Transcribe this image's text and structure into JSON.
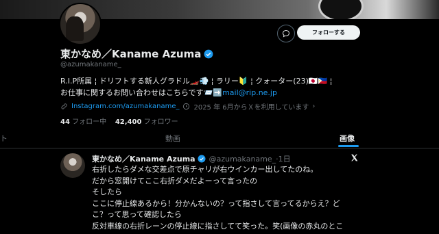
{
  "profile": {
    "name": "東かなめ／Kaname Azuma",
    "handle": "@azumakaname_",
    "bio_line1": "R.I.P所属 ¦ ドリフトする新人グラドル🏎️💨 ¦ ラリー🔰 ¦ クォーター(23)🇯🇵🇵🇭 ¦",
    "bio_line2_text": "お仕事に関するお問い合わせはこちらです📨➡️",
    "bio_line2_link": "mail@rip.ne.jp",
    "website": "Instagram.com/azumakaname_",
    "joined": "2025 年 6月からＸを利用しています",
    "following_count": "44",
    "following_label": "フォロー中",
    "followers_count": "42,400",
    "followers_label": "フォロワー"
  },
  "actions": {
    "follow_label": "フォローする"
  },
  "tabs": [
    {
      "label": "ト"
    },
    {
      "label": "動画"
    },
    {
      "label": "画像"
    }
  ],
  "post": {
    "name": "東かなめ／Kaname Azuma",
    "handle": "@azumakaname_·1日",
    "lines": [
      "右折したらダメな交差点で原チャリが右ウインカー出してたのね。",
      "だから窓開けてここ右折ダメだよーって言ったの",
      "そしたら",
      "ここに停止線あるから！分かんないの？って指さして言ってるからえ？ど",
      "こ？って思って確認したら",
      "反対車線の右折レーンの停止線に指さしてて笑った。笑(画像の赤丸のとこ"
    ]
  },
  "colors": {
    "accent": "#1d9bf0",
    "background": "#000000",
    "muted": "#71767b"
  }
}
